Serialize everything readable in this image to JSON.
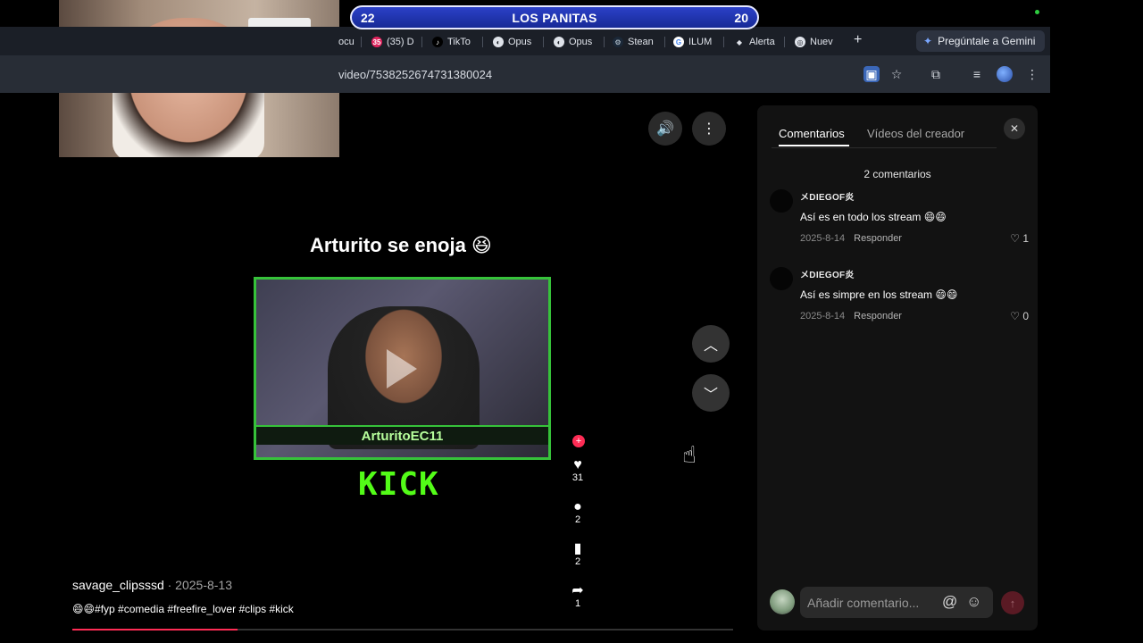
{
  "scoreboard": {
    "left_score": "22",
    "title": "LOS PANITAS",
    "right_score": "20"
  },
  "browser": {
    "tabs": [
      {
        "label": "ocu",
        "icon": "document-icon"
      },
      {
        "label": "(35) D",
        "icon": "notification-icon"
      },
      {
        "label": "TikTo",
        "icon": "tiktok-icon"
      },
      {
        "label": "Opus",
        "icon": "opus-icon"
      },
      {
        "label": "Opus",
        "icon": "opus-icon"
      },
      {
        "label": "Stean",
        "icon": "steam-icon"
      },
      {
        "label": "ILUM",
        "icon": "google-icon"
      },
      {
        "label": "Alerta",
        "icon": "alert-icon"
      },
      {
        "label": "Nuev",
        "icon": "chrome-icon"
      }
    ],
    "gemini_label": "Pregúntale a Gemini",
    "url": "video/7538252674731380024"
  },
  "video": {
    "title": "Arturito se enoja 😆",
    "streamer_name": "ArturitoEC11",
    "brand": "KICK",
    "likes": "31",
    "comments": "2",
    "saves": "2",
    "shares": "1",
    "progress_percent": 25
  },
  "caption": {
    "author": "savage_clipsssd",
    "date": " · 2025-8-13",
    "hashtags": "😄😄#fyp #comedia #freefire_lover #clips #kick"
  },
  "panel": {
    "tab_comments": "Comentarios",
    "tab_creator": "Vídeos del creador",
    "count": "2 comentarios",
    "comments": [
      {
        "user": "メDIEGOF炎",
        "text": "Así es en todo los stream 😄😄",
        "date": "2025-8-14",
        "reply": "Responder",
        "likes": "1"
      },
      {
        "user": "メDIEGOF炎",
        "text": "Así es simpre en los stream 😄😄",
        "date": "2025-8-14",
        "reply": "Responder",
        "likes": "0"
      }
    ],
    "input_placeholder": "Añadir comentario..."
  }
}
